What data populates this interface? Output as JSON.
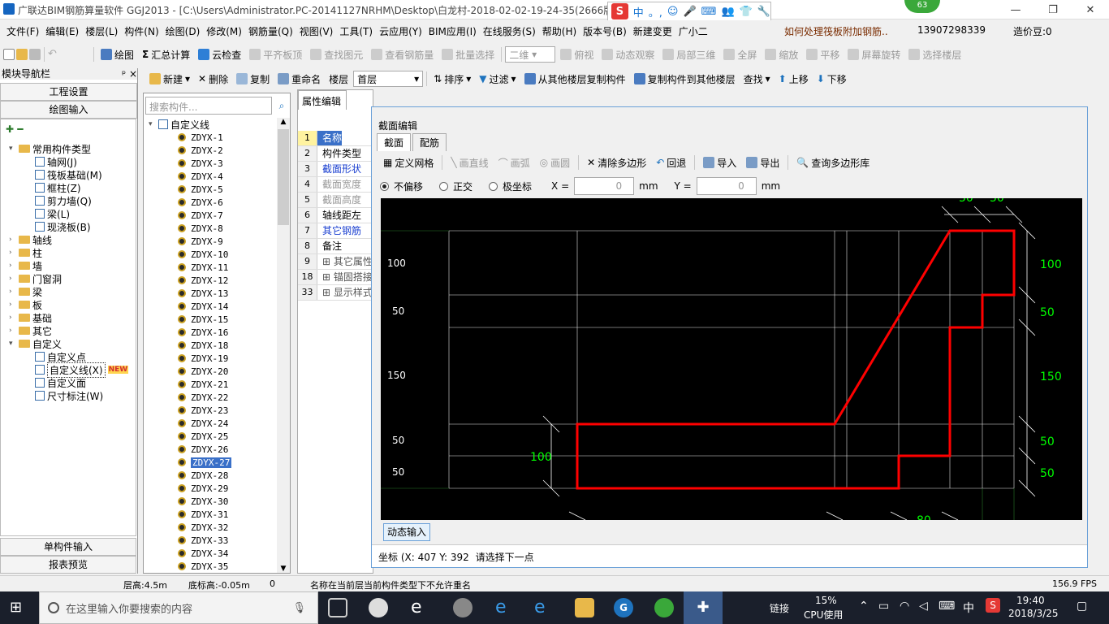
{
  "window": {
    "title": "广联达BIM钢筋算量软件 GGJ2013 - [C:\\Users\\Administrator.PC-20141127NRHM\\Desktop\\白龙村-2018-02-02-19-24-35(2666版",
    "badge": "63",
    "ime_chars": [
      "中",
      "。,",
      "☺",
      "🎤",
      "⌨",
      "👥",
      "👕",
      "🔧"
    ]
  },
  "menu": {
    "items": [
      "文件(F)",
      "编辑(E)",
      "楼层(L)",
      "构件(N)",
      "绘图(D)",
      "修改(M)",
      "钢筋量(Q)",
      "视图(V)",
      "工具(T)",
      "云应用(Y)",
      "BIM应用(I)",
      "在线服务(S)",
      "帮助(H)",
      "版本号(B)",
      "新建变更",
      "广小二"
    ],
    "question": "如何处理筏板附加钢筋..",
    "phone": "13907298339",
    "price": "造价豆:0"
  },
  "toolbar1": {
    "items": [
      "绘图",
      "汇总计算",
      "云检查",
      "平齐板顶",
      "查找图元",
      "查看钢筋量",
      "批量选择"
    ],
    "view_mode": "二维",
    "view_items": [
      "俯视",
      "动态观察",
      "局部三维",
      "全屏",
      "缩放",
      "平移",
      "屏幕旋转",
      "选择楼层"
    ]
  },
  "toolbar2": {
    "items": [
      "新建",
      "删除",
      "复制",
      "重命名"
    ],
    "floor_label": "楼层",
    "floor_value": "首层",
    "items2": [
      "排序",
      "过滤",
      "从其他楼层复制构件",
      "复制构件到其他楼层",
      "查找",
      "上移",
      "下移"
    ]
  },
  "leftnav": {
    "title": "模块导航栏",
    "pin": "ᵖ ×",
    "btn_engineering": "工程设置",
    "btn_drawing": "绘图输入",
    "tree": [
      {
        "label": "常用构件类型",
        "level": 0,
        "expanded": true
      },
      {
        "label": "轴网(J)",
        "level": 1
      },
      {
        "label": "筏板基础(M)",
        "level": 1
      },
      {
        "label": "框柱(Z)",
        "level": 1
      },
      {
        "label": "剪力墙(Q)",
        "level": 1
      },
      {
        "label": "梁(L)",
        "level": 1
      },
      {
        "label": "现浇板(B)",
        "level": 1
      },
      {
        "label": "轴线",
        "level": 0
      },
      {
        "label": "柱",
        "level": 0
      },
      {
        "label": "墙",
        "level": 0
      },
      {
        "label": "门窗洞",
        "level": 0
      },
      {
        "label": "梁",
        "level": 0
      },
      {
        "label": "板",
        "level": 0
      },
      {
        "label": "基础",
        "level": 0
      },
      {
        "label": "其它",
        "level": 0
      },
      {
        "label": "自定义",
        "level": 0,
        "expanded": true
      },
      {
        "label": "自定义点",
        "level": 1
      },
      {
        "label": "自定义线(X)",
        "level": 1,
        "selected": true
      },
      {
        "label": "自定义面",
        "level": 1
      },
      {
        "label": "尺寸标注(W)",
        "level": 1
      }
    ],
    "new_tag": "NEW",
    "btn_single": "单构件输入",
    "btn_report": "报表预览"
  },
  "components": {
    "search_placeholder": "搜索构件...",
    "root": "自定义线",
    "items": [
      "ZDYX-1",
      "ZDYX-2",
      "ZDYX-3",
      "ZDYX-4",
      "ZDYX-5",
      "ZDYX-6",
      "ZDYX-7",
      "ZDYX-8",
      "ZDYX-9",
      "ZDYX-10",
      "ZDYX-11",
      "ZDYX-12",
      "ZDYX-13",
      "ZDYX-14",
      "ZDYX-15",
      "ZDYX-16",
      "ZDYX-18",
      "ZDYX-19",
      "ZDYX-20",
      "ZDYX-21",
      "ZDYX-22",
      "ZDYX-23",
      "ZDYX-24",
      "ZDYX-25",
      "ZDYX-26",
      "ZDYX-27",
      "ZDYX-28",
      "ZDYX-29",
      "ZDYX-30",
      "ZDYX-31",
      "ZDYX-32",
      "ZDYX-33",
      "ZDYX-34",
      "ZDYX-35"
    ],
    "selected": "ZDYX-27"
  },
  "properties": {
    "tab": "属性编辑",
    "rows": [
      {
        "n": "1",
        "v": "名称",
        "style": "selected"
      },
      {
        "n": "2",
        "v": "构件类型",
        "style": "normal"
      },
      {
        "n": "3",
        "v": "截面形状",
        "style": "blue"
      },
      {
        "n": "4",
        "v": "截面宽度",
        "style": "gray"
      },
      {
        "n": "5",
        "v": "截面高度",
        "style": "gray"
      },
      {
        "n": "6",
        "v": "轴线距左",
        "style": "normal"
      },
      {
        "n": "7",
        "v": "其它钢筋",
        "style": "blue"
      },
      {
        "n": "8",
        "v": "备注",
        "style": "normal"
      },
      {
        "n": "9",
        "v": "其它属性",
        "style": "group"
      },
      {
        "n": "18",
        "v": "锚固搭接",
        "style": "group"
      },
      {
        "n": "33",
        "v": "显示样式",
        "style": "group"
      }
    ]
  },
  "dialog": {
    "title": "截面编辑",
    "tabs": [
      "截面",
      "配筋"
    ],
    "toolbar": [
      {
        "label": "定义网格",
        "enabled": true
      },
      {
        "label": "画直线",
        "enabled": false
      },
      {
        "label": "画弧",
        "enabled": false
      },
      {
        "label": "画圆",
        "enabled": false
      },
      {
        "label": "清除多边形",
        "enabled": true
      },
      {
        "label": "回退",
        "enabled": true
      },
      {
        "label": "导入",
        "enabled": true
      },
      {
        "label": "导出",
        "enabled": true
      },
      {
        "label": "查询多边形库",
        "enabled": true
      }
    ],
    "offset_options": [
      "不偏移",
      "正交",
      "极坐标"
    ],
    "x_label": "X =",
    "x_value": "0",
    "y_label": "Y =",
    "y_value": "0",
    "unit": "mm",
    "canvas": {
      "grid_color": "#ffffff",
      "polygon_color": "#ff0000",
      "dim_color": "#00ff00",
      "left_labels": [
        "100",
        "50",
        "150",
        "50",
        "50"
      ],
      "right_dims": [
        "100",
        "50",
        "150",
        "50",
        "50"
      ],
      "top_dims": [
        "50",
        "50"
      ],
      "bottom_dim": "80",
      "left_dim": "100"
    },
    "dynamic_input": "动态输入",
    "coord_label": "坐标 (X: 407 Y: 392",
    "status_prompt": "请选择下一点"
  },
  "statusbar": {
    "floor_height": "层高:4.5m",
    "bottom_height": "底标高:-0.05m",
    "count": "0",
    "message": "名称在当前层当前构件类型下不允许重名",
    "fps": "156.9 FPS"
  },
  "taskbar": {
    "search_placeholder": "在这里输入你要搜索的内容",
    "link_label": "链接",
    "cpu_percent": "15%",
    "cpu_label": "CPU使用",
    "ime": "中",
    "time": "19:40",
    "date": "2018/3/25"
  }
}
